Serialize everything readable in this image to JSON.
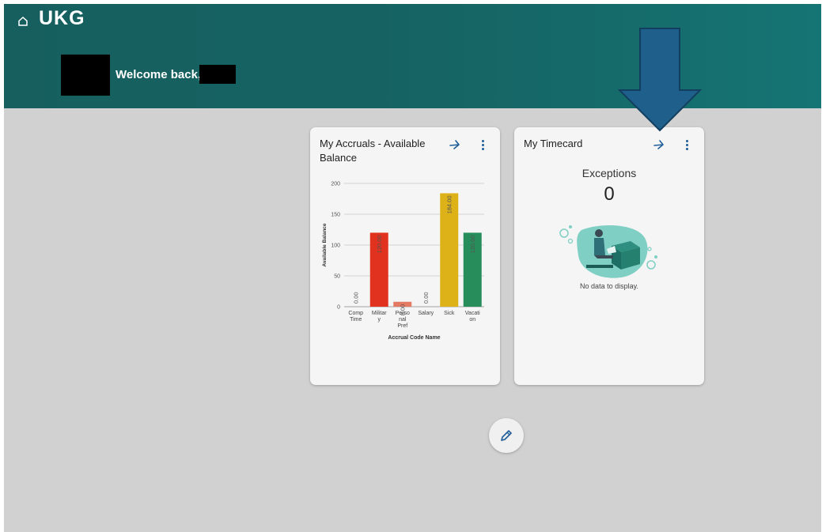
{
  "header": {
    "logo": "UKG",
    "welcome": "Welcome back,"
  },
  "accruals_card": {
    "title": "My Accruals - Available Balance"
  },
  "timecard_card": {
    "title": "My Timecard",
    "exceptions_label": "Exceptions",
    "exceptions_value": "0",
    "empty_message": "No data to display."
  },
  "icons": {
    "home": "home-icon",
    "open": "arrow-right-icon",
    "more": "more-vertical-icon",
    "edit": "pencil-icon"
  },
  "colors": {
    "header_start": "#175f5f",
    "header_end": "#157574",
    "accent": "#1f5d98",
    "annotation_arrow": "#1f5f8b"
  },
  "chart_data": {
    "type": "bar",
    "categories": [
      "Comp Time",
      "Military",
      "Personal Pref",
      "Salary",
      "Sick",
      "Vacation"
    ],
    "category_lines": [
      [
        "Comp",
        "Time"
      ],
      [
        "Militar",
        "y"
      ],
      [
        "Perso",
        "nal",
        "Pref"
      ],
      [
        "Salary"
      ],
      [
        "Sick"
      ],
      [
        "Vacati",
        "on"
      ]
    ],
    "values": [
      0,
      120,
      8,
      0,
      184,
      120
    ],
    "value_labels": [
      "0.00",
      "120.00",
      "8.00",
      "0.00",
      "184.00",
      "120.00"
    ],
    "bar_colors": [
      "#e0e0e0",
      "#e0321e",
      "#e57a64",
      "#e0e0e0",
      "#ddb219",
      "#268d5b"
    ],
    "xlabel": "Accrual Code Name",
    "ylabel": "Available Balance",
    "ylim": [
      0,
      200
    ],
    "yticks": [
      0,
      50,
      100,
      150,
      200
    ],
    "grid": true
  }
}
